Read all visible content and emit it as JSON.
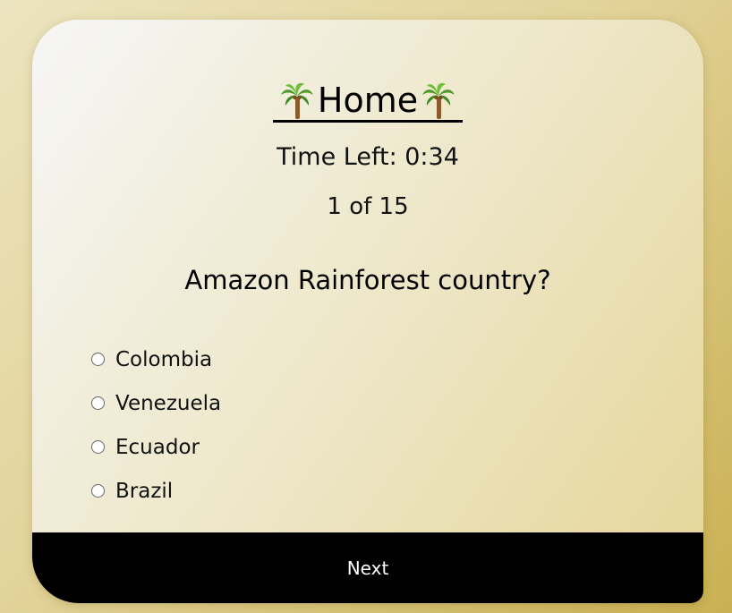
{
  "header": {
    "title": "Home",
    "icon": "palm-tree-icon"
  },
  "quiz": {
    "timer_text": "Time Left: 0:34",
    "progress_text": "1 of 15",
    "question": "Amazon Rainforest country?",
    "options": [
      {
        "label": "Colombia",
        "selected": false
      },
      {
        "label": "Venezuela",
        "selected": false
      },
      {
        "label": "Ecuador",
        "selected": false
      },
      {
        "label": "Brazil",
        "selected": false
      }
    ],
    "next_label": "Next"
  },
  "colors": {
    "background_accent": "#c9b052",
    "card_light": "#f6f6f6",
    "card_gold": "#e5d597",
    "next_bar": "#000000",
    "text": "#000000"
  }
}
